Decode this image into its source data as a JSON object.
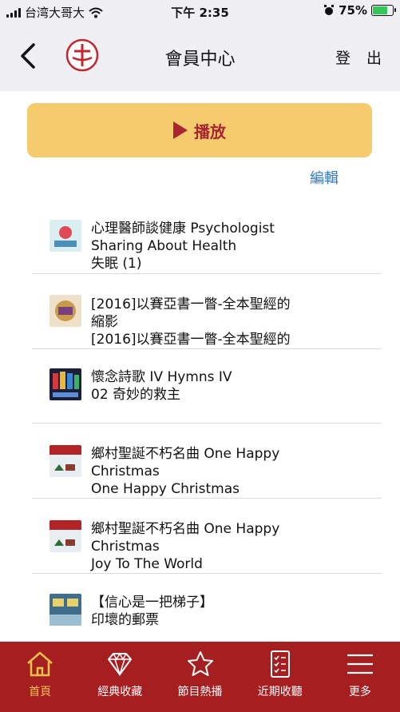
{
  "status_bar": {
    "carrier": "台湾大哥大",
    "time": "下午 2:35",
    "battery": "75%"
  },
  "header": {
    "title": "會員中心",
    "logout_label": "登 出"
  },
  "play_button": {
    "label": "播放"
  },
  "edit_label": "編輯",
  "tracks": [
    {
      "line1": "心理醫師談健康 Psychologist",
      "line2": "Sharing About Health",
      "line3": "失眠 (1)"
    },
    {
      "line1": "[2016]以賽亞書一瞥-全本聖經的",
      "line2": "縮影",
      "line3": "[2016]以賽亞書一瞥-全本聖經的"
    },
    {
      "line1": "懷念詩歌 IV Hymns IV",
      "line2": "02 奇妙的救主",
      "line3": ""
    },
    {
      "line1": "鄉村聖誕不朽名曲 One Happy",
      "line2": "Christmas",
      "line3": "One Happy Christmas"
    },
    {
      "line1": "鄉村聖誕不朽名曲 One Happy",
      "line2": "Christmas",
      "line3": "Joy To The World"
    },
    {
      "line1": "【信心是一把梯子】",
      "line2": "印壞的郵票",
      "line3": ""
    }
  ],
  "tabs": [
    {
      "label": "首頁",
      "icon": "home-icon"
    },
    {
      "label": "經典收藏",
      "icon": "diamond-icon"
    },
    {
      "label": "節目熱播",
      "icon": "star-icon"
    },
    {
      "label": "近期收聽",
      "icon": "notes-icon"
    },
    {
      "label": "更多",
      "icon": "menu-icon"
    }
  ],
  "colors": {
    "accent_red": "#a51f21",
    "play_yellow": "#f5cb6e",
    "link_blue": "#2f7ad6",
    "active_tab": "#f4c24b"
  }
}
